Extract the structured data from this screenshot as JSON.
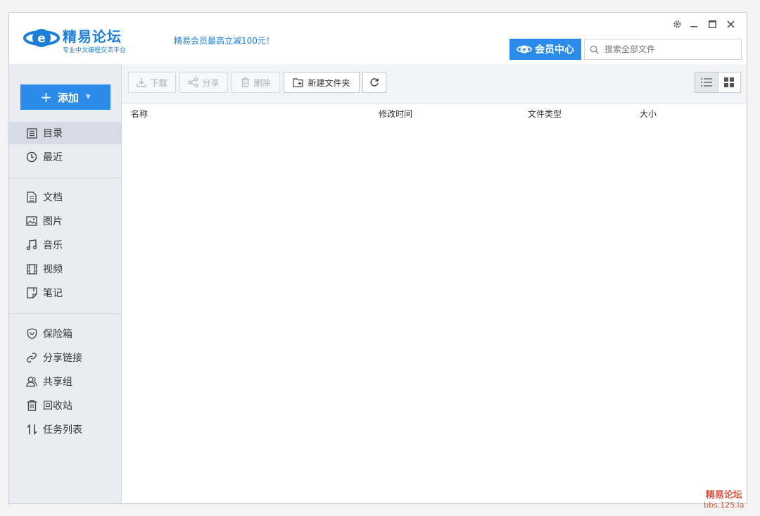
{
  "header": {
    "logo_title": "精易论坛",
    "logo_subtitle": "专业中文编程交流平台",
    "promo": "精易会员最高立减100元！",
    "vip_label": "会员中心",
    "search_placeholder": "搜索全部文件"
  },
  "sidebar": {
    "add_label": "添加",
    "items": [
      {
        "label": "目录",
        "icon": "list-icon"
      },
      {
        "label": "最近",
        "icon": "clock-icon"
      },
      {
        "label": "文档",
        "icon": "document-icon"
      },
      {
        "label": "图片",
        "icon": "image-icon"
      },
      {
        "label": "音乐",
        "icon": "music-icon"
      },
      {
        "label": "视频",
        "icon": "film-icon"
      },
      {
        "label": "笔记",
        "icon": "note-icon"
      },
      {
        "label": "保险箱",
        "icon": "shield-icon"
      },
      {
        "label": "分享链接",
        "icon": "link-icon"
      },
      {
        "label": "共享组",
        "icon": "users-icon"
      },
      {
        "label": "回收站",
        "icon": "trash-icon"
      },
      {
        "label": "任务列表",
        "icon": "transfer-icon"
      }
    ],
    "active_index": 0
  },
  "toolbar": {
    "download": "下载",
    "share": "分享",
    "delete": "删除",
    "new_folder": "新建文件夹"
  },
  "table": {
    "columns": [
      "名称",
      "修改时间",
      "文件类型",
      "大小"
    ]
  },
  "watermark": {
    "line1": "精易论坛",
    "line2": "bbs.125.la"
  },
  "colors": {
    "accent": "#2a8be8",
    "sidebar_bg": "#e9edf2",
    "watermark": "#d9533f"
  }
}
